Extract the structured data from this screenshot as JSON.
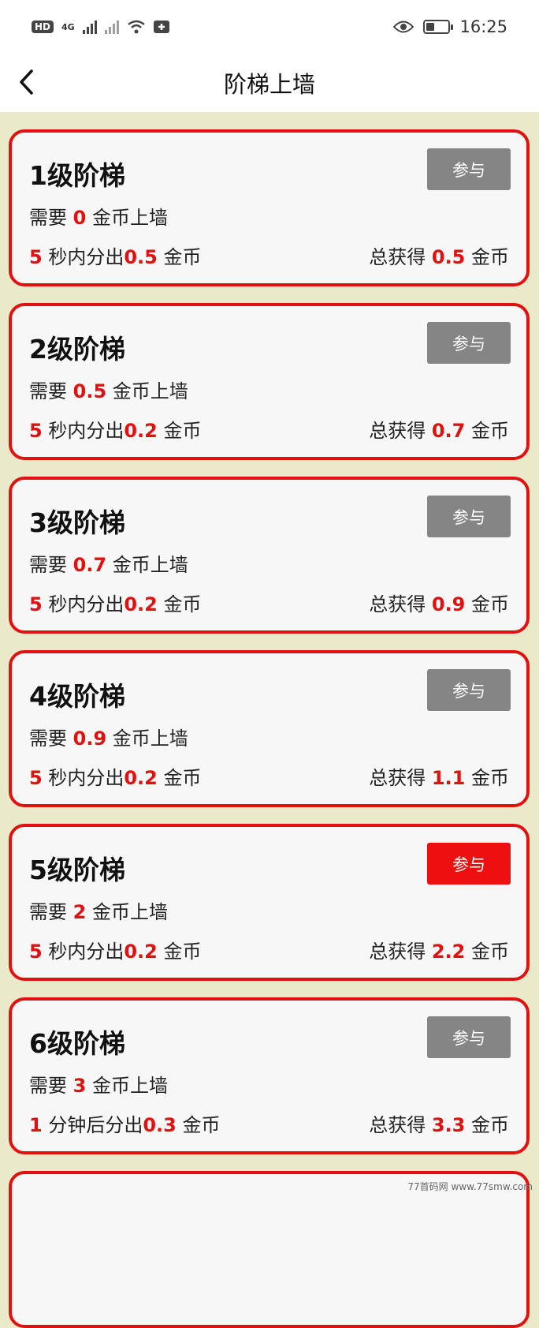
{
  "status_bar": {
    "hd_label": "HD",
    "net_label": "4G",
    "time": "16:25"
  },
  "nav": {
    "title": "阶梯上墙"
  },
  "labels": {
    "need_prefix": "需要",
    "need_suffix": "金币上墙",
    "coin": "金币",
    "total_prefix": "总获得"
  },
  "cards": [
    {
      "title": "1级阶梯",
      "button": "参与",
      "active": false,
      "need": "0",
      "rate_num": "5",
      "rate_unit": "秒内分出",
      "rate_amount": "0.5",
      "total": "0.5"
    },
    {
      "title": "2级阶梯",
      "button": "参与",
      "active": false,
      "need": "0.5",
      "rate_num": "5",
      "rate_unit": "秒内分出",
      "rate_amount": "0.2",
      "total": "0.7"
    },
    {
      "title": "3级阶梯",
      "button": "参与",
      "active": false,
      "need": "0.7",
      "rate_num": "5",
      "rate_unit": "秒内分出",
      "rate_amount": "0.2",
      "total": "0.9"
    },
    {
      "title": "4级阶梯",
      "button": "参与",
      "active": false,
      "need": "0.9",
      "rate_num": "5",
      "rate_unit": "秒内分出",
      "rate_amount": "0.2",
      "total": "1.1"
    },
    {
      "title": "5级阶梯",
      "button": "参与",
      "active": true,
      "need": "2",
      "rate_num": "5",
      "rate_unit": "秒内分出",
      "rate_amount": "0.2",
      "total": "2.2"
    },
    {
      "title": "6级阶梯",
      "button": "参与",
      "active": false,
      "need": "3",
      "rate_num": "1",
      "rate_unit": "分钟后分出",
      "rate_amount": "0.3",
      "total": "3.3"
    }
  ],
  "colors": {
    "accent": "#e31010",
    "button_inactive": "#858585",
    "background": "#eaeaca"
  },
  "watermark": "77首码网 www.77smw.com"
}
